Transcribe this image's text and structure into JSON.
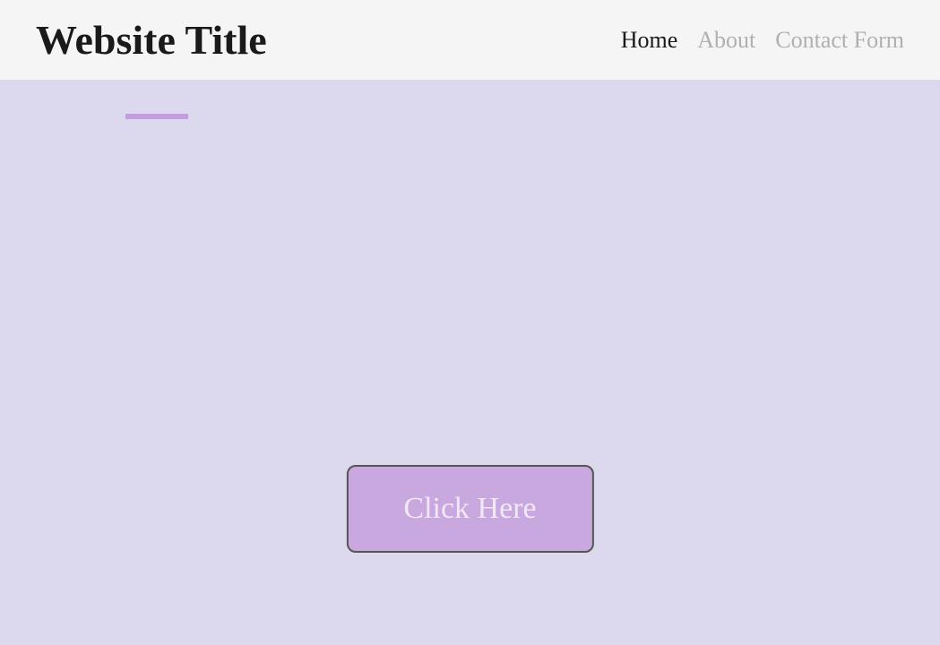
{
  "header": {
    "title": "Website Title",
    "nav": [
      {
        "label": "Home",
        "active": true
      },
      {
        "label": "About",
        "active": false
      },
      {
        "label": "Contact Form",
        "active": false
      }
    ]
  },
  "hero": {
    "cta_label": "Click Here"
  },
  "colors": {
    "hero_bg": "#dcd8ee",
    "accent": "#c49de0",
    "button_bg": "#c9a8e0"
  }
}
